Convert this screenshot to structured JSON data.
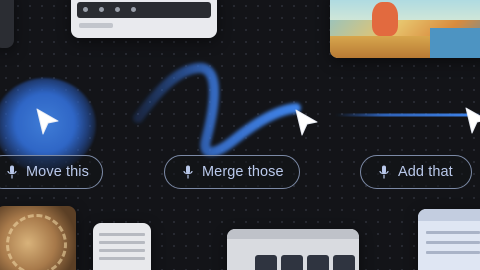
{
  "voice_commands": [
    {
      "label": "Move this"
    },
    {
      "label": "Merge those"
    },
    {
      "label": "Add that"
    }
  ],
  "icons": {
    "command_icon": "microphone-icon",
    "pointer_icon": "cursor-arrow-icon"
  },
  "colors": {
    "background": "#131418",
    "accent_blue": "#3f7cd6",
    "pill_border": "#7c8aa6",
    "pill_text": "#b9c8ea",
    "cursor": "#ffffff"
  }
}
